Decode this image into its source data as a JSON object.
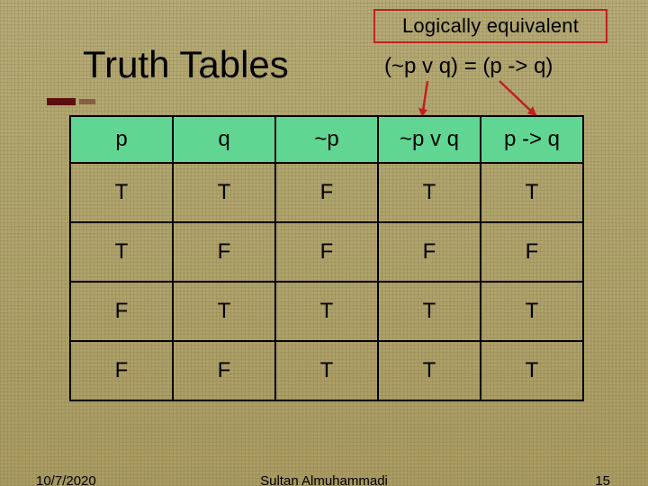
{
  "callout_label": "Logically equivalent",
  "equivalence": "(~p v q) = (p -> q)",
  "title": "Truth Tables",
  "table": {
    "headers": [
      "p",
      "q",
      "~p",
      "~p v q",
      "p -> q"
    ],
    "rows": [
      [
        "T",
        "T",
        "F",
        "T",
        "T"
      ],
      [
        "T",
        "F",
        "F",
        "F",
        "F"
      ],
      [
        "F",
        "T",
        "T",
        "T",
        "T"
      ],
      [
        "F",
        "F",
        "T",
        "T",
        "T"
      ]
    ]
  },
  "footer": {
    "date": "10/7/2020",
    "author": "Sultan Almuhammadi",
    "page": "15"
  },
  "chart_data": {
    "type": "table",
    "title": "Truth Tables",
    "note": "(~p v q) = (p -> q)",
    "columns": [
      "p",
      "q",
      "~p",
      "~p v q",
      "p -> q"
    ],
    "rows": [
      [
        "T",
        "T",
        "F",
        "T",
        "T"
      ],
      [
        "T",
        "F",
        "F",
        "F",
        "F"
      ],
      [
        "F",
        "T",
        "T",
        "T",
        "T"
      ],
      [
        "F",
        "F",
        "T",
        "T",
        "T"
      ]
    ]
  }
}
